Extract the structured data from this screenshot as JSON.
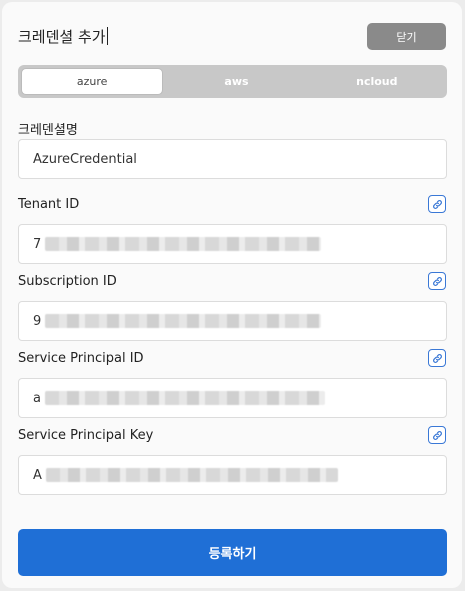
{
  "header": {
    "title": "크레덴셜 추가",
    "close_label": "닫기"
  },
  "tabs": [
    {
      "label": "azure",
      "active": true
    },
    {
      "label": "aws",
      "active": false
    },
    {
      "label": "ncloud",
      "active": false
    }
  ],
  "form": {
    "credential_name": {
      "label": "크레덴셜명",
      "value": "AzureCredential"
    },
    "tenant_id": {
      "label": "Tenant ID",
      "value_prefix": "7"
    },
    "subscription_id": {
      "label": "Subscription ID",
      "value_prefix": "9"
    },
    "service_principal_id": {
      "label": "Service Principal ID",
      "value_prefix": "a"
    },
    "service_principal_key": {
      "label": "Service Principal Key",
      "value_prefix": "A"
    }
  },
  "submit_label": "등록하기",
  "colors": {
    "accent": "#1f6fd6",
    "link_icon": "#3a78d6",
    "close_button": "#8a8a8a",
    "tab_bar": "#c8c8c8"
  },
  "icons": {
    "copy_link": "link-icon"
  }
}
